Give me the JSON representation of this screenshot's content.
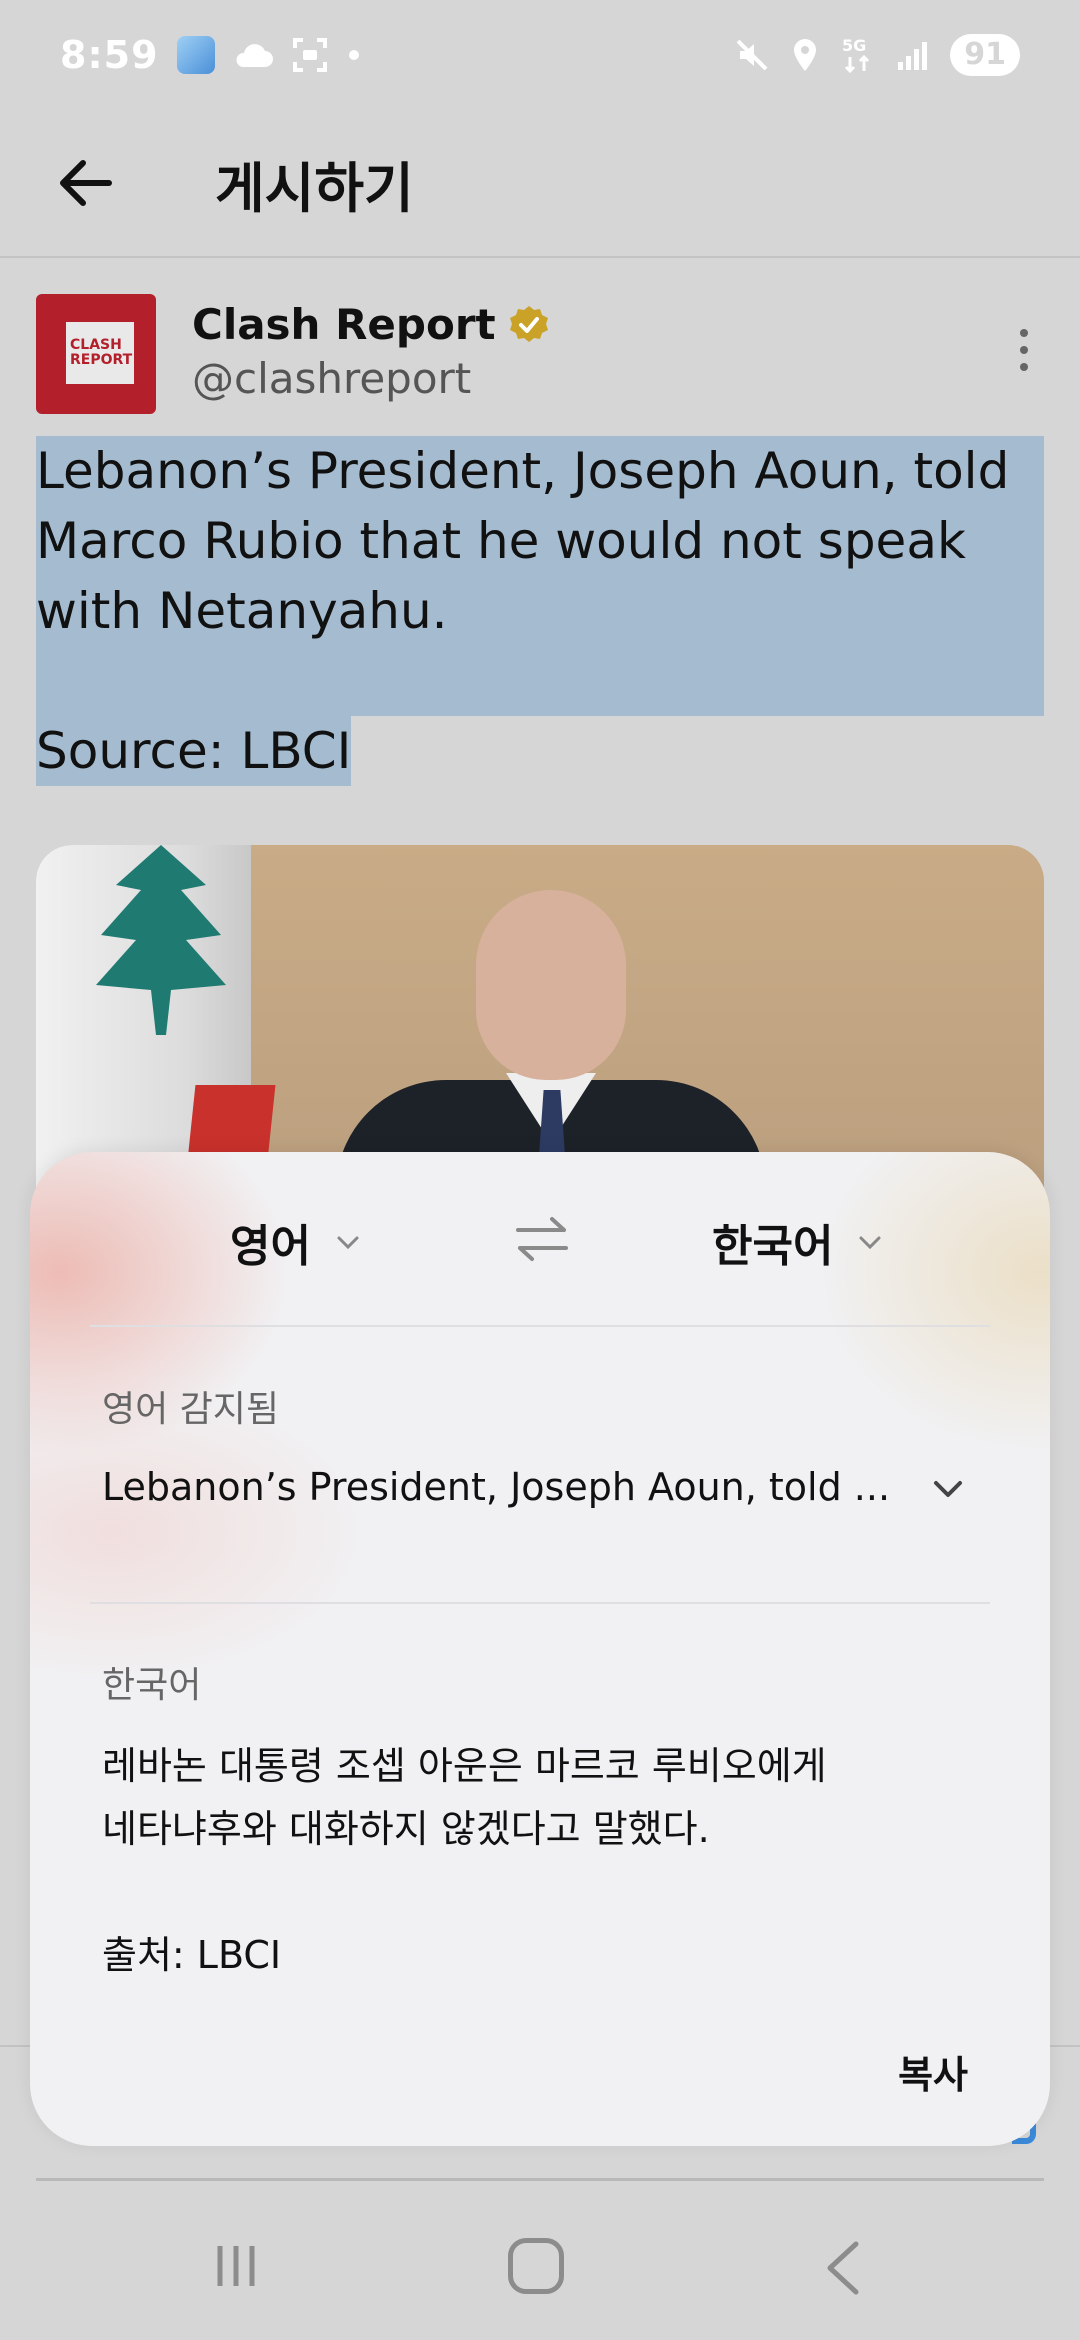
{
  "status_bar": {
    "time": "8:59",
    "battery": "91",
    "icons": [
      "weather-app-icon",
      "cloud-icon",
      "screenshot-icon",
      "dot-icon",
      "mute-icon",
      "location-icon",
      "5g-icon",
      "signal-icon"
    ]
  },
  "header": {
    "back_icon": "arrow-left-icon",
    "title": "게시하기"
  },
  "post": {
    "author_name": "Clash Report",
    "author_handle": "@clashreport",
    "avatar_line1": "CLASH",
    "avatar_line2": "REPORT",
    "verified": true,
    "text_lines": [
      "Lebanon’s President, Joseph Aoun, told",
      "Marco Rubio that he would not speak",
      "with Netanyahu."
    ],
    "source_line": "Source: LBCI",
    "image_alt": "photo-of-president-with-flag"
  },
  "translation_sheet": {
    "source_language": "영어",
    "target_language": "한국어",
    "detected_label": "영어 감지됨",
    "source_text": "Lebanon’s President, Joseph Aoun, told ...",
    "target_label": "한국어",
    "target_lines": [
      "레바논 대통령 조셉 아운은 마르코 루비오에게",
      "네타냐후와 대화하지 않겠다고 말했다.",
      "",
      "출처: LBCI"
    ],
    "copy_label": "복사"
  },
  "colors": {
    "background": "#d6d6d6",
    "highlight": "#a5bcd0",
    "verified_gold": "#c9a227",
    "avatar_red": "#b3202c",
    "accent_blue": "#3b8ad9"
  }
}
